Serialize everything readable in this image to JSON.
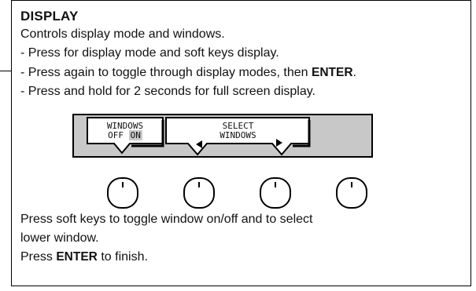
{
  "title": "DISPLAY",
  "description": "Controls display mode and windows.",
  "steps": [
    "- Press for display mode and soft keys display.",
    "- Press again to toggle through display modes, then ",
    "- Press and hold for 2 seconds for full screen display."
  ],
  "enter_label": "ENTER",
  "enter_suffix": ".",
  "softkeys": {
    "windows_line1": "WINDOWS",
    "windows_off": "OFF",
    "windows_on": "ON",
    "select_line1": "SELECT",
    "select_line2": "WINDOWS"
  },
  "footer": {
    "line1": "Press soft keys to toggle window on/off and to select",
    "line2": "lower window.",
    "press": "Press ",
    "enter": "ENTER",
    "finish": " to finish."
  },
  "colors": {
    "screen_bg": "#c8c8c8",
    "border": "#000000"
  },
  "button_count": 4
}
